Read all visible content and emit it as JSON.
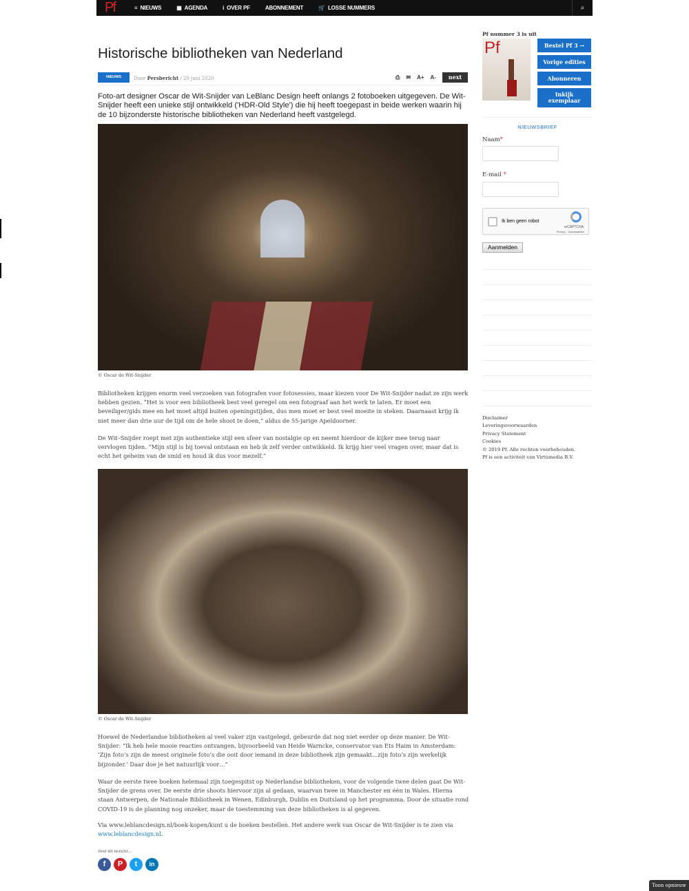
{
  "nav": {
    "logo": "Pf",
    "items": [
      {
        "label": "NIEUWS",
        "icon": "≡"
      },
      {
        "label": "AGENDA",
        "icon": "▦"
      },
      {
        "label": "OVER PF",
        "icon": "i"
      },
      {
        "label": "ABONNEMENT",
        "icon": ""
      },
      {
        "label": "LOSSE NUMMERS",
        "icon": "🛒"
      }
    ],
    "search_icon": "⌕"
  },
  "article": {
    "title": "Historische bibliotheken van Nederland",
    "category": "NIEUWS",
    "by_prefix": "Door",
    "author": "Persbericht",
    "date": "/ 20 juni 2020",
    "tools": {
      "print": "⎙",
      "mail": "✉",
      "font_up": "A+",
      "font_down": "A-",
      "next": "next"
    },
    "lead": "Foto-art designer Oscar de Wit-Snijder van LeBlanc Design heeft onlangs 2 fotoboeken uitgegeven. De Wit-Snijder heeft een unieke stijl ontwikkeld ('HDR-Old Style') die hij heeft toegepast in beide werken waarin hij de 10 bijzonderste historische bibliotheken van Nederland heeft vastgelegd.",
    "caption1": "© Oscar de Wit-Snijder",
    "p1": "Bibliotheken krijgen enorm veel verzoeken van fotografen voor fotosessies, maar kiezen voor De Wit-Snijder nadat ze zijn werk hebben gezien. “Het is voor een bibliotheek best veel geregel om een fotograaf aan het werk te laten. Er moet een beveiliger/gids mee en het moet altijd buiten openingstijden, dus men moet er best veel moeite in steken. Daarnaast krijg ik niet meer dan drie uur de tijd om de hele shoot te doen,” aldus de 55-jarige Apeldoorner.",
    "p2": "De Wit–Snijder roept met zijn authentieke stijl een sfeer van nostalgie op en neemt hierdoor de kijker mee terug naar vervlogen tijden. “Mijn stijl is bij toeval ontstaan en heb ik zelf verder ontwikkeld. Ik krijg hier veel vragen over, maar dat is echt het geheim van de smid en houd ik dus voor mezelf.”",
    "caption2": "© Oscar de Wit-Snijder",
    "p3": "Hoewel de Nederlandse bibliotheken al veel vaker zijn vastgelegd, gebeurde dat nog niet eerder op deze manier. De Wit-Snijder: “Ik heb hele mooie reacties ontvangen, bijvoorbeeld van Heide Warncke, conservator van Ets Haim in Amsterdam: ‘Zijn foto’s zijn de meest originele foto’s die ooit door iemand in deze bibliotheek zijn gemaakt…zijn foto’s zijn werkelijk bijzonder.’ Daar doe je het natuurlijk voor…”",
    "p4": "Waar de eerste twee boeken helemaal zijn toegespitst op Nederlandse bibliotheken, voor de volgende twee delen gaat De Wit-Snijder de grens over. De eerste drie shoots hiervoor zijn al gedaan, waarvan twee in Manchester en één in Wales. Hierna staan Antwerpen, de Nationale Bibliotheek in Wenen, Edinburgh, Dublin en Duitsland op het programma. Door de situatie rond COVID-19 is de planning nog onzeker, maar de toestemming van deze bibliotheken is al gegeven.",
    "p5": "Via www.leblancdesign.nl/boek-kopen/kunt u de boeken bestellen. Het andere werk van Oscar de Wit-Snijder is te zien via",
    "p5_link": "www.leblancdesign.nl",
    "p5_end": ".",
    "share_label": "Deel dit bericht...",
    "share": [
      {
        "name": "facebook",
        "glyph": "f",
        "color": "#3b5998"
      },
      {
        "name": "pinterest",
        "glyph": "P",
        "color": "#cb2027"
      },
      {
        "name": "twitter",
        "glyph": "t",
        "color": "#1da1f2"
      },
      {
        "name": "linkedin",
        "glyph": "in",
        "color": "#0077b5"
      }
    ]
  },
  "sidebar": {
    "issue": "Pf nummer 3 is uit",
    "cover_logo": "Pf",
    "buttons": [
      "Bestel Pf 3 →",
      "Vorige edities",
      "Abonneren",
      "Inkijk exemplaar"
    ],
    "newsletter": "NIEUWSBRIEF",
    "name_label": "Naam",
    "email_label": "E-mail",
    "required": "*",
    "captcha": {
      "label": "Ik ben geen robot",
      "brand": "reCAPTCHA",
      "links": "Privacy - Voorwaarden"
    },
    "submit": "Aanmelden",
    "footer": [
      "Disclaimer",
      "Leveringsvoorwaarden",
      "Privacy Statement",
      "Cookies",
      "© 2019 Pf. Alle rechten voorbehouden.",
      "Pf is een activiteit van Virtùmedia B.V."
    ]
  },
  "toon": "Toon opnieuw",
  "colors": {
    "accent": "#1a6fc9",
    "brand": "#d0262a",
    "topbar": "#111111"
  }
}
